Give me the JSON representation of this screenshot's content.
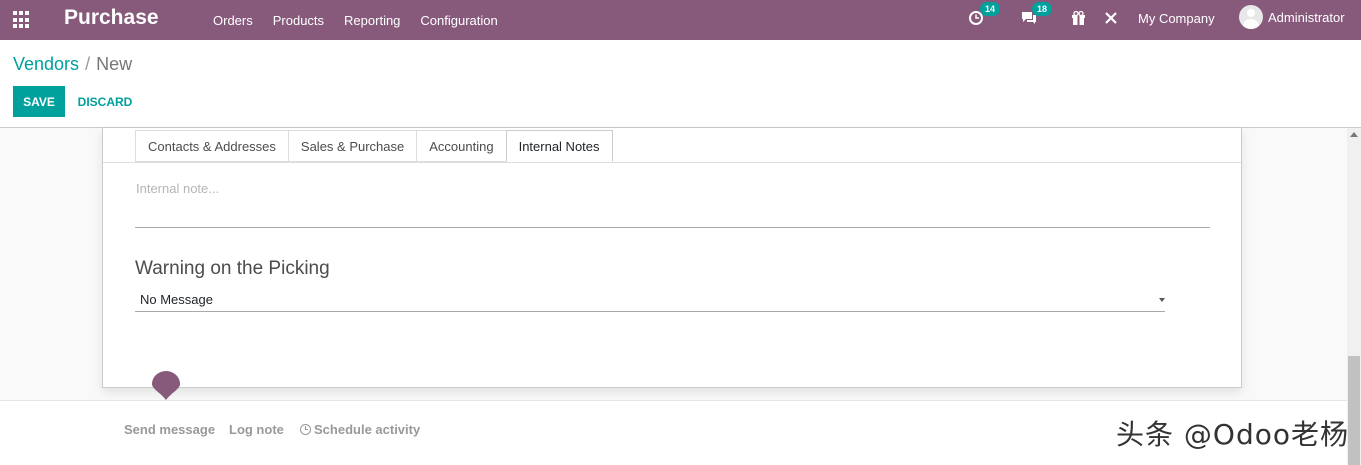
{
  "navbar": {
    "brand": "Purchase",
    "menu": [
      "Orders",
      "Products",
      "Reporting",
      "Configuration"
    ],
    "activity_count": "14",
    "message_count": "18",
    "company": "My Company",
    "user": "Administrator",
    "color": "#875a7b"
  },
  "breadcrumb": {
    "parent": "Vendors",
    "separator": "/",
    "current": "New"
  },
  "buttons": {
    "save": "SAVE",
    "discard": "DISCARD"
  },
  "tabs": [
    {
      "label": "Contacts & Addresses",
      "active": false
    },
    {
      "label": "Sales & Purchase",
      "active": false
    },
    {
      "label": "Accounting",
      "active": false
    },
    {
      "label": "Internal Notes",
      "active": true
    }
  ],
  "form": {
    "note_placeholder": "Internal note...",
    "warning_title": "Warning on the Picking",
    "warning_value": "No Message"
  },
  "chatter": {
    "send_message": "Send message",
    "log_note": "Log note",
    "schedule_activity": "Schedule activity"
  },
  "watermark": "头条 @Odoo老杨",
  "accent_color": "#00a09d"
}
